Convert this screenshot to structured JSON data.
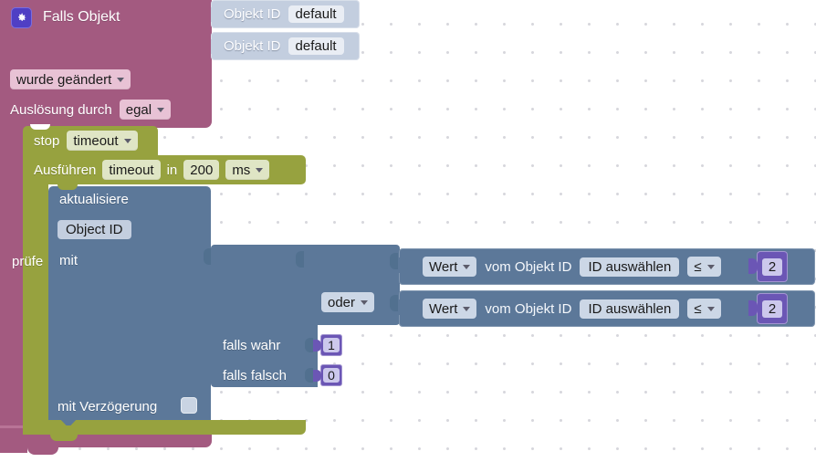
{
  "editor": {
    "name": "blockly-workspace",
    "background": "#ffffff",
    "grid_dot_color": "#d7d7dd",
    "grid_spacing_px": 31
  },
  "colors": {
    "event_block": "#a35a80",
    "event_field": "#e8c2d5",
    "timer_block": "#97a23f",
    "timer_field": "#dfe5c5",
    "action_block": "#5c7899",
    "value_block": "#c3cedf",
    "value_field": "#ccd7e6",
    "math_block": "#6b56b5",
    "math_field": "#ccc8ec",
    "gear_badge": "#4f3fc4"
  },
  "event_block": {
    "icon": "gear-icon",
    "title": "Falls Objekt",
    "condition_dropdown": "wurde geändert",
    "trigger_label": "Auslösung durch",
    "trigger_dropdown": "egal"
  },
  "object_id_blocks": [
    {
      "label": "Objekt ID",
      "value": "default"
    },
    {
      "label": "Objekt ID",
      "value": "default"
    }
  ],
  "stop_block": {
    "label": "stop",
    "dropdown": "timeout"
  },
  "execute_block": {
    "label": "Ausführen",
    "name_field": "timeout",
    "in_label": "in",
    "delay_value": "200",
    "unit_dropdown": "ms"
  },
  "update_block": {
    "label": "aktualisiere",
    "object_id_chip": "Object ID",
    "with_label": "mit",
    "delay_label": "mit Verzögerung",
    "delay_checked": false
  },
  "check_block": {
    "label": "prüfe",
    "logic_operator": "oder",
    "if_true_label": "falls wahr",
    "if_true_value": "1",
    "if_false_label": "falls falsch",
    "if_false_value": "0"
  },
  "conditions": [
    {
      "value_dropdown": "Wert",
      "from_label": "vom Objekt ID",
      "id_selector": "ID auswählen",
      "operator": "≤",
      "compare_value": "2"
    },
    {
      "value_dropdown": "Wert",
      "from_label": "vom Objekt ID",
      "id_selector": "ID auswählen",
      "operator": "≤",
      "compare_value": "2"
    }
  ]
}
